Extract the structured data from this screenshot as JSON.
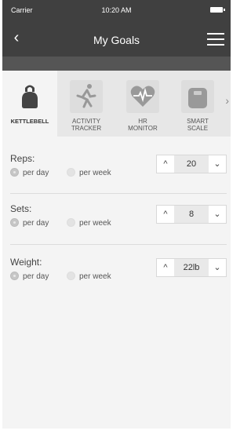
{
  "status_bar": {
    "carrier": "Carrier",
    "time": "10:20 AM"
  },
  "nav": {
    "back_icon": "‹",
    "title": "My Goals",
    "menu_icon": "hamburger-icon"
  },
  "tabs": [
    {
      "label": "KETTLEBELL",
      "icon": "kettlebell-icon",
      "active": true
    },
    {
      "label": "ACTIVITY\nTRACKER",
      "icon": "runner-icon",
      "active": false
    },
    {
      "label": "HR\nMONITOR",
      "icon": "heart-rate-icon",
      "active": false
    },
    {
      "label": "SMART\nSCALE",
      "icon": "scale-icon",
      "active": false
    }
  ],
  "tabs_more": "›",
  "goals": [
    {
      "label": "Reps:",
      "opt_day": "per day",
      "opt_week": "per week",
      "selected": "day",
      "value": "20",
      "dec": "^",
      "inc": "⌄"
    },
    {
      "label": "Sets:",
      "opt_day": "per day",
      "opt_week": "per week",
      "selected": "day",
      "value": "8",
      "dec": "^",
      "inc": "⌄"
    },
    {
      "label": "Weight:",
      "opt_day": "per day",
      "opt_week": "per week",
      "selected": "day",
      "value": "22lb",
      "dec": "^",
      "inc": "⌄"
    }
  ],
  "colors": {
    "header": "#404040",
    "band": "#555555",
    "background": "#f4f4f4"
  }
}
